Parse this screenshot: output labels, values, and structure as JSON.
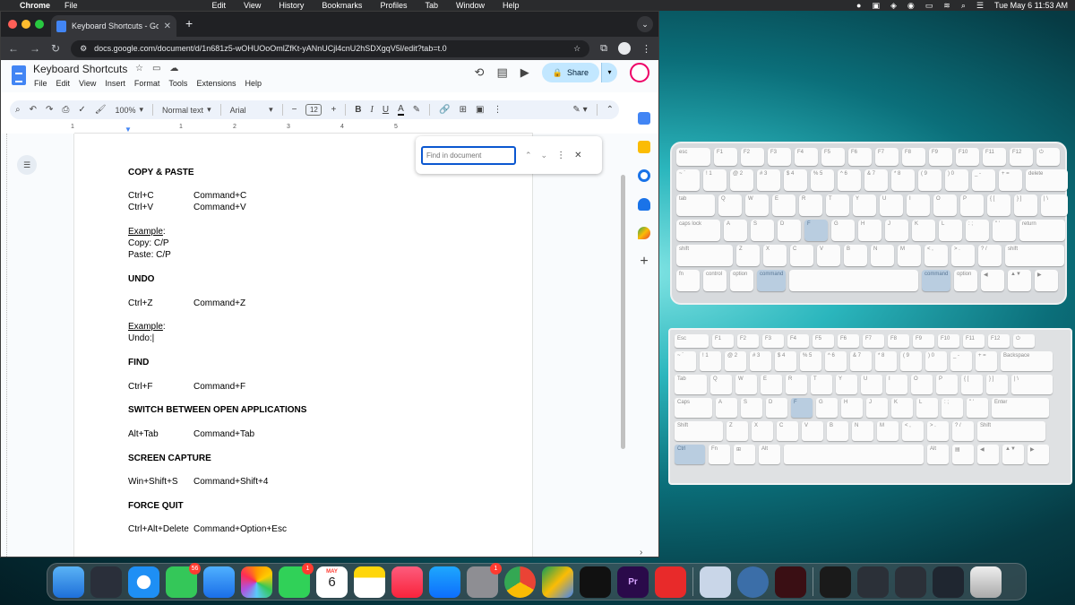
{
  "menubar": {
    "app_name": "Chrome",
    "items": [
      "File",
      "Edit",
      "View",
      "History",
      "Bookmarks",
      "Profiles",
      "Tab",
      "Window",
      "Help"
    ],
    "clock": "Tue May 6  11:53 AM"
  },
  "browser": {
    "tab_title": "Keyboard Shortcuts - Google Docs",
    "url": "docs.google.com/document/d/1n681z5-wOHUOoOmlZfKt-yANnUCjl4cnU2hSDXgqV5l/edit?tab=t.0"
  },
  "docs": {
    "title": "Keyboard Shortcuts",
    "menu": [
      "File",
      "Edit",
      "View",
      "Insert",
      "Format",
      "Tools",
      "Extensions",
      "Help"
    ],
    "share_label": "Share",
    "toolbar": {
      "zoom": "100%",
      "style": "Normal text",
      "font": "Arial",
      "font_size": "12"
    },
    "ruler_numbers": [
      "1",
      "1",
      "2",
      "3",
      "4",
      "5"
    ],
    "find_placeholder": "Find in document"
  },
  "document": {
    "lines": [
      {
        "text": "COPY & PASTE",
        "style": "heading"
      },
      {
        "text": "Ctrl+C",
        "col2": "Command+C"
      },
      {
        "text": "Ctrl+V",
        "col2": "Command+V"
      },
      {
        "text": "Example",
        "suffix": ":",
        "style": "underline"
      },
      {
        "text": "Copy: C/P"
      },
      {
        "text": "Paste: C/P"
      },
      {
        "text": "UNDO",
        "style": "heading"
      },
      {
        "text": "Ctrl+Z",
        "col2": "Command+Z"
      },
      {
        "text": "Example",
        "suffix": ":",
        "style": "underline"
      },
      {
        "text": "Undo:|"
      },
      {
        "text": "FIND",
        "style": "heading"
      },
      {
        "text": "Ctrl+F",
        "col2": "Command+F"
      },
      {
        "text": "SWITCH BETWEEN OPEN APPLICATIONS",
        "style": "heading"
      },
      {
        "text": "Alt+Tab",
        "col2": "Command+Tab"
      },
      {
        "text": "SCREEN CAPTURE",
        "style": "heading"
      },
      {
        "text": "Win+Shift+S",
        "col2": "Command+Shift+4"
      },
      {
        "text": "FORCE QUIT",
        "style": "heading"
      },
      {
        "text": "Ctrl+Alt+Delete",
        "col2": "Command+Option+Esc"
      }
    ]
  },
  "mac_keyboard": {
    "highlight": [
      "F",
      "command",
      "command"
    ],
    "rows": [
      [
        "esc",
        "F1",
        "F2",
        "F3",
        "F4",
        "F5",
        "F6",
        "F7",
        "F8",
        "F9",
        "F10",
        "F11",
        "F12",
        "⏻"
      ],
      [
        "~ `",
        "! 1",
        "@ 2",
        "# 3",
        "$ 4",
        "% 5",
        "^ 6",
        "& 7",
        "* 8",
        "( 9",
        ") 0",
        "_ -",
        "+ =",
        "delete"
      ],
      [
        "tab",
        "Q",
        "W",
        "E",
        "R",
        "T",
        "Y",
        "U",
        "I",
        "O",
        "P",
        "{ [",
        "} ]",
        "| \\"
      ],
      [
        "caps lock",
        "A",
        "S",
        "D",
        "F",
        "G",
        "H",
        "J",
        "K",
        "L",
        ": ;",
        "\" '",
        "return"
      ],
      [
        "shift",
        "Z",
        "X",
        "C",
        "V",
        "B",
        "N",
        "M",
        "< ,",
        "> .",
        "? /",
        "shift"
      ],
      [
        "fn",
        "control",
        "option",
        "command",
        "",
        "command",
        "option",
        "◀",
        "▲▼",
        "▶"
      ]
    ]
  },
  "pc_keyboard": {
    "highlight": [
      "F",
      "Ctrl"
    ],
    "rows": [
      [
        "Esc",
        "F1",
        "F2",
        "F3",
        "F4",
        "F5",
        "F6",
        "F7",
        "F8",
        "F9",
        "F10",
        "F11",
        "F12",
        "⏻"
      ],
      [
        "~ `",
        "! 1",
        "@ 2",
        "# 3",
        "$ 4",
        "% 5",
        "^ 6",
        "& 7",
        "* 8",
        "( 9",
        ") 0",
        "_ -",
        "+ =",
        "Backspace"
      ],
      [
        "Tab",
        "Q",
        "W",
        "E",
        "R",
        "T",
        "Y",
        "U",
        "I",
        "O",
        "P",
        "{ [",
        "} ]",
        "| \\"
      ],
      [
        "Caps",
        "A",
        "S",
        "D",
        "F",
        "G",
        "H",
        "J",
        "K",
        "L",
        ": ;",
        "\" '",
        "Enter"
      ],
      [
        "Shift",
        "Z",
        "X",
        "C",
        "V",
        "B",
        "N",
        "M",
        "< ,",
        "> .",
        "? /",
        "Shift"
      ],
      [
        "Ctrl",
        "Fn",
        "⊞",
        "Alt",
        "",
        "Alt",
        "▤",
        "◀",
        "▲▼",
        "▶"
      ]
    ]
  },
  "dock": {
    "messages_badge": "56",
    "facetime_badge": "1",
    "calendar_month": "MAY",
    "calendar_day": "6",
    "settings_badge": "1",
    "premiere_label": "Pr"
  }
}
